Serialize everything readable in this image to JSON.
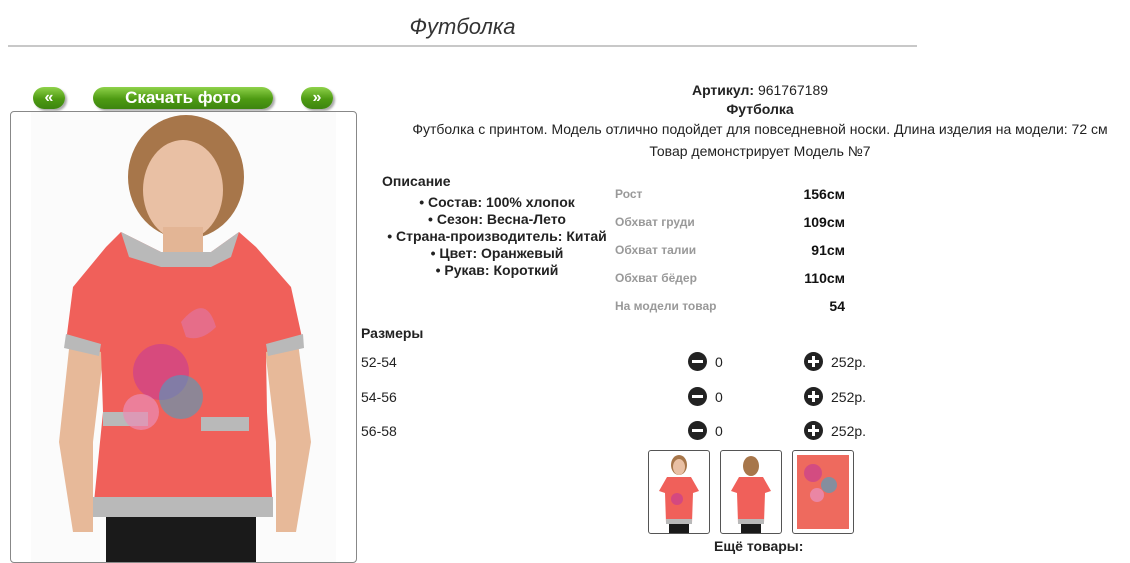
{
  "page": {
    "title": "Футболка"
  },
  "nav": {
    "prev_label": "«",
    "download_label": "Скачать фото",
    "next_label": "»"
  },
  "product": {
    "article_label": "Артикул:",
    "article_value": "961767189",
    "name": "Футболка",
    "description": "Футболка с принтом. Модель отлично подойдет для повседневной носки. Длина изделия на модели: 72 см",
    "model_note": "Товар демонстрирует Модель №7"
  },
  "features": {
    "title": "Описание",
    "items": [
      "Состав: 100% хлопок",
      "Сезон: Весна-Лето",
      "Страна-производитель: Китай",
      "Цвет: Оранжевый",
      "Рукав: Короткий"
    ]
  },
  "model_params": [
    {
      "label": "Рост",
      "value": "156см"
    },
    {
      "label": "Обхват груди",
      "value": "109см"
    },
    {
      "label": "Обхват талии",
      "value": "91см"
    },
    {
      "label": "Обхват бёдер",
      "value": "110см"
    },
    {
      "label": "На модели товар",
      "value": "54"
    }
  ],
  "sizes": {
    "title": "Размеры",
    "rows": [
      {
        "size": "52-54",
        "qty": "0",
        "price": "252р."
      },
      {
        "size": "54-56",
        "qty": "0",
        "price": "252р."
      },
      {
        "size": "56-58",
        "qty": "0",
        "price": "252р."
      }
    ]
  },
  "more": {
    "label": "Ещё товары:"
  },
  "colors": {
    "accent_green": "#4d9a12",
    "shirt": "#f0605a",
    "trim": "#b9b9b9"
  }
}
